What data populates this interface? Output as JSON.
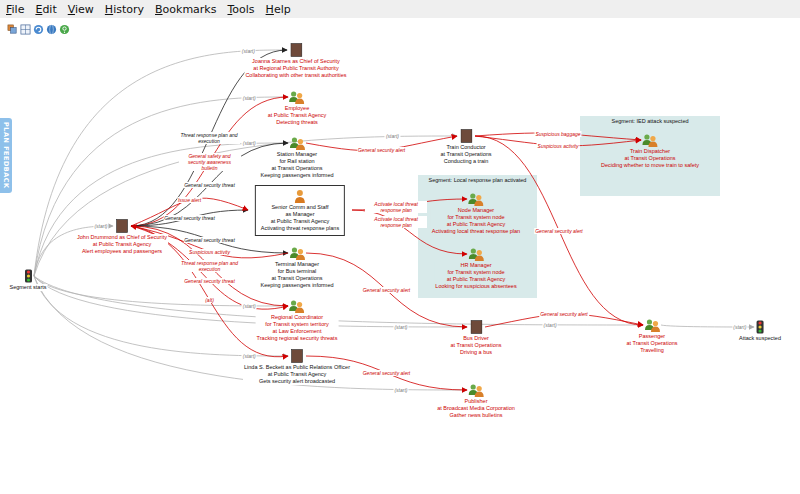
{
  "menu": [
    "File",
    "Edit",
    "View",
    "History",
    "Bookmarks",
    "Tools",
    "Help"
  ],
  "side_tab": {
    "label": "PLAN FEEDBACK"
  },
  "diagram": {
    "segments": [
      {
        "title": "Segment: IED attack suspected"
      },
      {
        "title": "Segment: Local response plan activated"
      }
    ],
    "nodes": [
      {
        "kind": "milestone",
        "lines": [
          "Segment starts"
        ],
        "alerted": false,
        "framed": false
      },
      {
        "kind": "photo",
        "lines": [
          "John Drummond as Chief of Security",
          "at Public Transit Agency",
          "Alert employees and passengers"
        ],
        "alerted": true,
        "framed": false
      },
      {
        "kind": "photo",
        "lines": [
          "Joanna Starnes as Chief of Security",
          "at Regional Public Transit Authority",
          "Collaborating with other transit authorities"
        ],
        "alerted": true,
        "framed": false
      },
      {
        "kind": "group",
        "lines": [
          "Employee",
          "at Public Transit Agency",
          "Detecting threats"
        ],
        "alerted": true,
        "framed": false
      },
      {
        "kind": "group",
        "lines": [
          "Station Manager",
          "for Rail station",
          "at Transit Operations",
          "Keeping passengers informed"
        ],
        "alerted": false,
        "framed": false
      },
      {
        "kind": "person",
        "lines": [
          "Senior Comm and Staff",
          "as Manager",
          "at Public Transit Agency",
          "Activating threat response plans"
        ],
        "alerted": false,
        "framed": true
      },
      {
        "kind": "group",
        "lines": [
          "Terminal Manager",
          "for Bus terminal",
          "at Transit Operations",
          "Keeping passengers informed"
        ],
        "alerted": false,
        "framed": false
      },
      {
        "kind": "group",
        "lines": [
          "Regional Coordinator",
          "for Transit system territory",
          "at Law Enforcement",
          "Tracking regional security threats"
        ],
        "alerted": true,
        "framed": false
      },
      {
        "kind": "photo",
        "lines": [
          "Linda S. Beckett as Public Relations Officer",
          "at Public Transit Agency",
          "Gets security alert broadcasted"
        ],
        "alerted": false,
        "framed": false
      },
      {
        "kind": "photo",
        "lines": [
          "Train Conductor",
          "at Transit Operations",
          "Conducting a train"
        ],
        "alerted": false,
        "framed": false
      },
      {
        "kind": "group",
        "lines": [
          "Node Manager",
          "for Transit system node",
          "at Public Transit Agency",
          "Activating local threat response plan"
        ],
        "alerted": true,
        "framed": false
      },
      {
        "kind": "group",
        "lines": [
          "HR Manager",
          "for Transit system node",
          "at Public Transit Agency",
          "Looking for suspicious absentees"
        ],
        "alerted": true,
        "framed": false
      },
      {
        "kind": "group",
        "lines": [
          "Train Dispatcher",
          "at Transit Operations",
          "Deciding whether to move train to safety"
        ],
        "alerted": true,
        "framed": false
      },
      {
        "kind": "photo",
        "lines": [
          "Bus Driver",
          "at Transit Operations",
          "Driving a bus"
        ],
        "alerted": true,
        "framed": false
      },
      {
        "kind": "group",
        "lines": [
          "Passenger",
          "at Transit Operations",
          "Travelling"
        ],
        "alerted": true,
        "framed": false
      },
      {
        "kind": "group",
        "lines": [
          "Publisher",
          "at Broadcast Media Corporation",
          "Gather news bulletins"
        ],
        "alerted": true,
        "framed": false
      },
      {
        "kind": "milestone",
        "lines": [
          "Attack suspected"
        ],
        "alerted": false,
        "framed": false
      }
    ],
    "edges": [
      {
        "from": 0,
        "to": 1,
        "label": "(start)",
        "kind": "start"
      },
      {
        "from": 0,
        "to": 2,
        "label": "(start)",
        "kind": "start"
      },
      {
        "from": 0,
        "to": 3,
        "label": "(start)",
        "kind": "start"
      },
      {
        "from": 0,
        "to": 4,
        "label": "(start)",
        "kind": "start"
      },
      {
        "from": 0,
        "to": 7,
        "label": "(start)",
        "kind": "start"
      },
      {
        "from": 0,
        "to": 8,
        "label": "(start)",
        "kind": "start"
      },
      {
        "from": 0,
        "to": 9,
        "label": "(start)",
        "kind": "start"
      },
      {
        "from": 0,
        "to": 13,
        "label": "(start)",
        "kind": "start"
      },
      {
        "from": 0,
        "to": 14,
        "label": "(start)",
        "kind": "start"
      },
      {
        "from": 0,
        "to": 15,
        "label": "(start)",
        "kind": "start"
      },
      {
        "from": 14,
        "to": 16,
        "label": "(start)",
        "kind": "start"
      },
      {
        "from": 1,
        "to": 2,
        "label": "Threat response plan and execution",
        "kind": "flow"
      },
      {
        "from": 1,
        "to": 3,
        "label": "General safety and security awareness bulletin",
        "kind": "alert"
      },
      {
        "from": 1,
        "to": 4,
        "label": "General security threat",
        "kind": "flow"
      },
      {
        "from": 1,
        "to": 5,
        "label": "General security threat",
        "kind": "flow"
      },
      {
        "from": 1,
        "to": 5,
        "label": "Issue alert",
        "kind": "alert"
      },
      {
        "from": 1,
        "to": 6,
        "label": "General security threat",
        "kind": "flow"
      },
      {
        "from": 6,
        "to": 1,
        "label": "Suspicious activity",
        "kind": "alert"
      },
      {
        "from": 1,
        "to": 7,
        "label": "Threat response plan and execution",
        "kind": "alert"
      },
      {
        "from": 1,
        "to": 7,
        "label": "General security threat",
        "kind": "alert"
      },
      {
        "from": 1,
        "to": 8,
        "label": "(alt)",
        "kind": "alert"
      },
      {
        "from": 4,
        "to": 9,
        "label": "General security alert",
        "kind": "alert"
      },
      {
        "from": 5,
        "to": 10,
        "label": "Activate local threat response plan",
        "kind": "alert"
      },
      {
        "from": 5,
        "to": 11,
        "label": "Activate local threat response plan",
        "kind": "alert"
      },
      {
        "from": 6,
        "to": 13,
        "label": "General security alert",
        "kind": "alert"
      },
      {
        "from": 8,
        "to": 15,
        "label": "General security alert",
        "kind": "alert"
      },
      {
        "from": 9,
        "to": 12,
        "label": "Suspicious baggage",
        "kind": "alert"
      },
      {
        "from": 9,
        "to": 12,
        "label": "Suspicious activity",
        "kind": "alert"
      },
      {
        "from": 9,
        "to": 14,
        "label": "General security alert",
        "kind": "alert"
      },
      {
        "from": 13,
        "to": 14,
        "label": "General security alert",
        "kind": "alert"
      }
    ]
  }
}
